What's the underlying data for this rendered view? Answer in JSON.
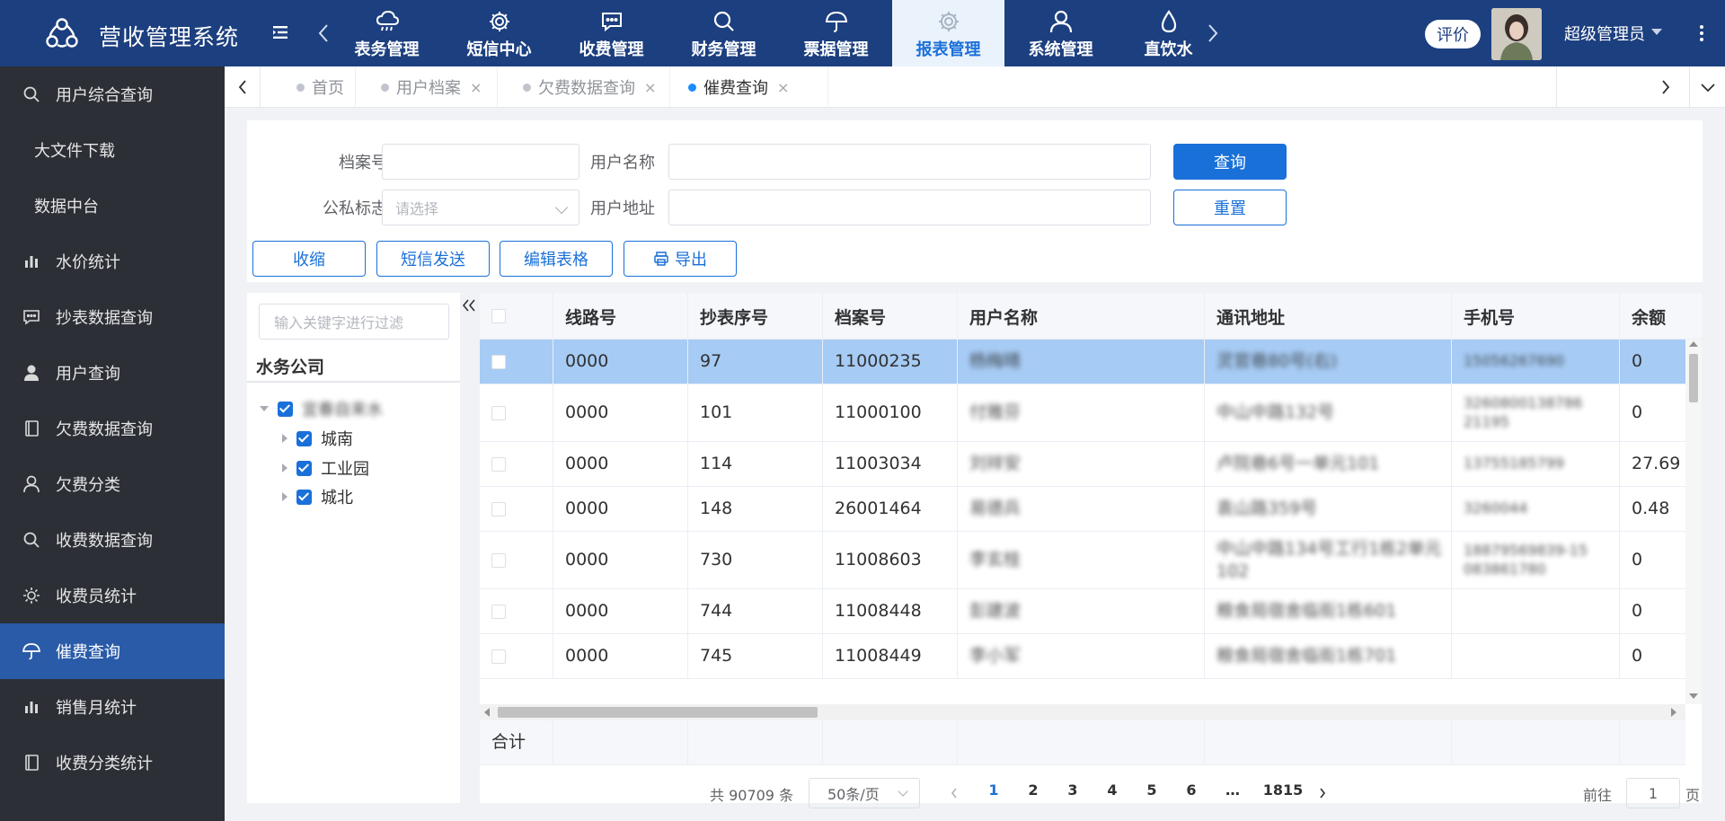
{
  "app": {
    "title": "营收管理系统"
  },
  "modules": [
    {
      "label": "表务管理",
      "icon": "cloud-rain-icon",
      "active": false
    },
    {
      "label": "短信中心",
      "icon": "gear-icon",
      "active": false
    },
    {
      "label": "收费管理",
      "icon": "message-icon",
      "active": false
    },
    {
      "label": "财务管理",
      "icon": "search-icon",
      "active": false
    },
    {
      "label": "票据管理",
      "icon": "umbrella-icon",
      "active": false
    },
    {
      "label": "报表管理",
      "icon": "gear-icon",
      "active": true
    },
    {
      "label": "系统管理",
      "icon": "user-icon",
      "active": false
    },
    {
      "label": "直饮水",
      "icon": "water-drop-icon",
      "active": false
    }
  ],
  "header": {
    "review_label": "评价",
    "user_name": "超级管理员"
  },
  "sidebar": {
    "items": [
      {
        "label": "用户综合查询",
        "icon": "search-icon"
      },
      {
        "label": "大文件下载",
        "icon": ""
      },
      {
        "label": "数据中台",
        "icon": ""
      },
      {
        "label": "水价统计",
        "icon": "bar-chart-icon"
      },
      {
        "label": "抄表数据查询",
        "icon": "message-icon"
      },
      {
        "label": "用户查询",
        "icon": "user-solid-icon"
      },
      {
        "label": "欠费数据查询",
        "icon": "notebook-icon"
      },
      {
        "label": "欠费分类",
        "icon": "user-icon"
      },
      {
        "label": "收费数据查询",
        "icon": "search-icon"
      },
      {
        "label": "收费员统计",
        "icon": "sun-icon"
      },
      {
        "label": "催费查询",
        "icon": "umbrella-icon",
        "active": true
      },
      {
        "label": "销售月统计",
        "icon": "bar-chart-icon"
      },
      {
        "label": "收费分类统计",
        "icon": "notebook-icon"
      }
    ]
  },
  "tabs": [
    {
      "label": "首页",
      "closable": false,
      "active": false
    },
    {
      "label": "用户档案",
      "closable": true,
      "active": false
    },
    {
      "label": "欠费数据查询",
      "closable": true,
      "active": false
    },
    {
      "label": "催费查询",
      "closable": true,
      "active": true
    }
  ],
  "filters": {
    "archive_no_label": "档案号",
    "archive_no_value": "",
    "user_name_label": "用户名称",
    "user_name_value": "",
    "public_private_label": "公私标志",
    "public_private_placeholder": "请选择",
    "user_address_label": "用户地址",
    "user_address_value": "",
    "query_button": "查询",
    "reset_button": "重置"
  },
  "toolbar": {
    "collapse_button": "收缩",
    "sms_button": "短信发送",
    "edit_table_button": "编辑表格",
    "export_button": "导出"
  },
  "tree": {
    "filter_placeholder": "输入关键字进行过滤",
    "title": "水务公司",
    "root": {
      "label": "宜春自来水",
      "checked": true,
      "expanded": true
    },
    "children": [
      {
        "label": "城南",
        "checked": true
      },
      {
        "label": "工业园",
        "checked": true
      },
      {
        "label": "城北",
        "checked": true
      }
    ]
  },
  "table": {
    "columns": [
      "线路号",
      "抄表序号",
      "档案号",
      "用户名称",
      "通讯地址",
      "手机号",
      "余额"
    ],
    "rows": [
      {
        "line": "0000",
        "seq": "97",
        "archive": "11000235",
        "name": "杨梅晴",
        "address": "灵官巷80号(右)",
        "phone": "15056267690",
        "balance": "0",
        "selected": true
      },
      {
        "line": "0000",
        "seq": "101",
        "archive": "11000100",
        "name": "付雅芬",
        "address": "中山中路132号",
        "phone": "3260800138786 21195",
        "balance": "0",
        "selected": false
      },
      {
        "line": "0000",
        "seq": "114",
        "archive": "11003034",
        "name": "刘祥安",
        "address": "卢院巷6号一单元101",
        "phone": "13755185799",
        "balance": "27.69",
        "selected": false
      },
      {
        "line": "0000",
        "seq": "148",
        "archive": "26001464",
        "name": "易德兵",
        "address": "袁山路359号",
        "phone": "3260044",
        "balance": "0.48",
        "selected": false
      },
      {
        "line": "0000",
        "seq": "730",
        "archive": "11008603",
        "name": "李玄桂",
        "address": "中山中路134号工行1栋2单元102",
        "phone": "18879569839-15 083861780",
        "balance": "0",
        "selected": false
      },
      {
        "line": "0000",
        "seq": "744",
        "archive": "11008448",
        "name": "彭建波",
        "address": "粮食局宿舍临街1栋601",
        "phone": "",
        "balance": "0",
        "selected": false
      },
      {
        "line": "0000",
        "seq": "745",
        "archive": "11008449",
        "name": "李小军",
        "address": "粮食局宿舍临街1栋701",
        "phone": "",
        "balance": "0",
        "selected": false
      }
    ],
    "summary_label": "合计"
  },
  "pagination": {
    "total_text": "共 90709 条",
    "page_size": "50条/页",
    "pages": [
      "1",
      "2",
      "3",
      "4",
      "5",
      "6",
      "…",
      "1815"
    ],
    "current_page": "1",
    "goto_label": "前往",
    "goto_value": "1",
    "page_unit": "页"
  }
}
